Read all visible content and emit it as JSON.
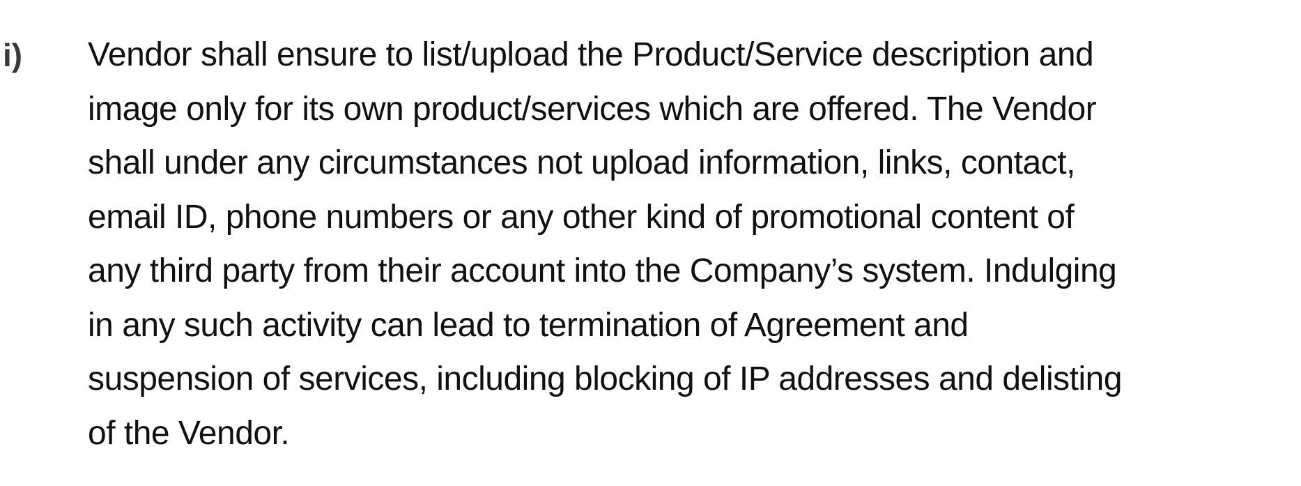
{
  "clause": {
    "marker": "i)",
    "lines": [
      "Vendor shall ensure to list/upload the Product/Service description and",
      "image only for its own product/services which are offered. The Vendor",
      "shall under any circumstances not upload information, links, contact,",
      "email ID, phone numbers or any other kind of promotional content of",
      "any third party from their account into the Company’s system. Indulging",
      "in any such activity can lead to termination of Agreement and",
      "suspension of services, including blocking of IP addresses and delisting",
      "of the Vendor."
    ]
  }
}
